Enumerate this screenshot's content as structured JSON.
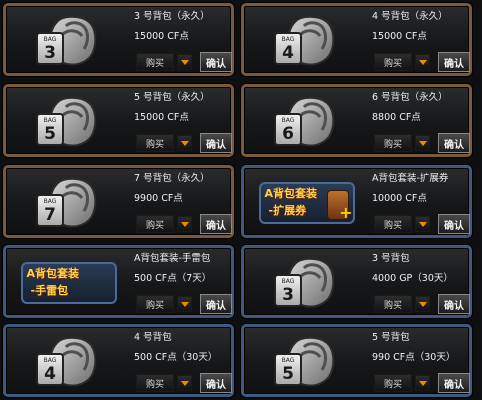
{
  "cards": [
    {
      "name": "3 号背包（永久）",
      "price": "15000 CF点",
      "icon": "bag-3-icon",
      "bag_number": "3",
      "buy": "购买",
      "confirm": "确认"
    },
    {
      "name": "4 号背包（永久）",
      "price": "15000 CF点",
      "icon": "bag-4-icon",
      "bag_number": "4",
      "buy": "购买",
      "confirm": "确认"
    },
    {
      "name": "5 号背包（永久）",
      "price": "15000 CF点",
      "icon": "bag-5-icon",
      "bag_number": "5",
      "buy": "购买",
      "confirm": "确认"
    },
    {
      "name": "6 号背包（永久）",
      "price": "8800 CF点",
      "icon": "bag-6-icon",
      "bag_number": "6",
      "buy": "购买",
      "confirm": "确认"
    },
    {
      "name": "7 号背包（永久）",
      "price": "9900 CF点",
      "icon": "bag-7-icon",
      "bag_number": "7",
      "buy": "购买",
      "confirm": "确认"
    },
    {
      "name": "A背包套装-扩展券",
      "price": "10000 CF点",
      "icon": "bag-suit-expansion-icon",
      "banner_line1": "A背包套装",
      "banner_line2": "-扩展券",
      "buy": "购买",
      "confirm": "确认"
    },
    {
      "name": "A背包套装-手雷包",
      "price": "500 CF点（7天）",
      "icon": "bag-suit-grenade-icon",
      "banner_line1": "A背包套装",
      "banner_line2": "-手雷包",
      "buy": "购买",
      "confirm": "确认"
    },
    {
      "name": "3 号背包",
      "price": "4000 GP（30天）",
      "icon": "bag-3-icon",
      "bag_number": "3",
      "buy": "购买",
      "confirm": "确认"
    },
    {
      "name": "4 号背包",
      "price": "500 CF点（30天）",
      "icon": "bag-4-icon",
      "bag_number": "4",
      "buy": "购买",
      "confirm": "确认"
    },
    {
      "name": "5 号背包",
      "price": "990 CF点（30天）",
      "icon": "bag-5-icon",
      "bag_number": "5",
      "buy": "购买",
      "confirm": "确认"
    }
  ],
  "bag_label": "BAG",
  "colors": {
    "accent_orange": "#f08a00",
    "border_gold": "#7a5a3a",
    "border_blue": "#3f5a80",
    "border_gray": "#6e6a63"
  }
}
